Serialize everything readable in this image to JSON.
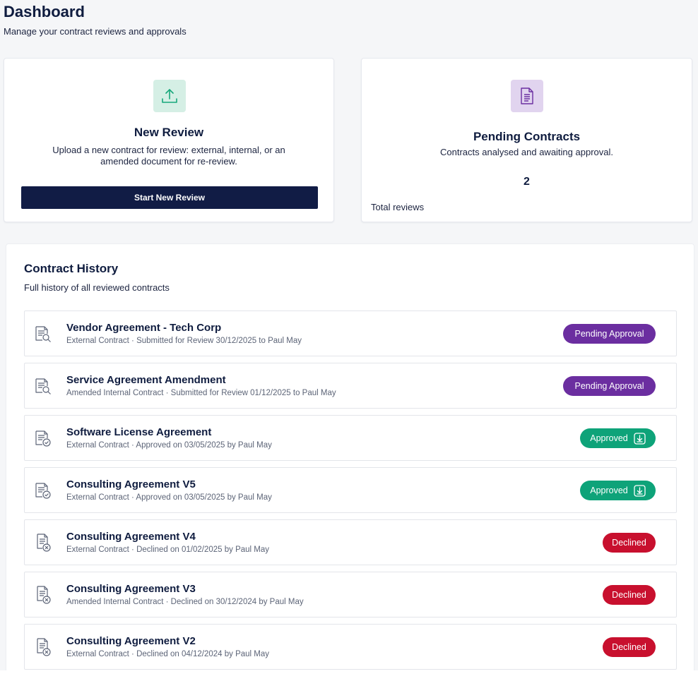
{
  "header": {
    "title": "Dashboard",
    "subtitle": "Manage your contract reviews and approvals"
  },
  "new_review": {
    "icon": "upload-icon",
    "title": "New Review",
    "description": "Upload a new contract for review: external, internal, or an amended document for re-review.",
    "button_label": "Start New Review"
  },
  "pending": {
    "icon": "document-icon",
    "title": "Pending Contracts",
    "description": "Contracts analysed and awaiting approval.",
    "count": "2",
    "count_label": "Total reviews"
  },
  "history": {
    "title": "Contract History",
    "subtitle": "Full history of all reviewed contracts",
    "rows": [
      {
        "icon": "document-search-icon",
        "title": "Vendor Agreement - Tech Corp",
        "meta": "External Contract · Submitted for Review 30/12/2025 to Paul May",
        "status": "Pending Approval",
        "status_type": "pending"
      },
      {
        "icon": "document-search-icon",
        "title": "Service Agreement Amendment",
        "meta": "Amended Internal Contract · Submitted for Review 01/12/2025 to Paul May",
        "status": "Pending Approval",
        "status_type": "pending"
      },
      {
        "icon": "document-check-icon",
        "title": "Software License Agreement",
        "meta": "External Contract · Approved on 03/05/2025 by Paul May",
        "status": "Approved",
        "status_type": "approved"
      },
      {
        "icon": "document-check-icon",
        "title": "Consulting Agreement V5",
        "meta": "External Contract · Approved on 03/05/2025 by Paul May",
        "status": "Approved",
        "status_type": "approved"
      },
      {
        "icon": "document-x-icon",
        "title": "Consulting Agreement V4",
        "meta": "External Contract · Declined on 01/02/2025 by Paul May",
        "status": "Declined",
        "status_type": "declined"
      },
      {
        "icon": "document-x-icon",
        "title": "Consulting Agreement V3",
        "meta": "Amended Internal Contract · Declined on 30/12/2024 by Paul May",
        "status": "Declined",
        "status_type": "declined"
      },
      {
        "icon": "document-x-icon",
        "title": "Consulting Agreement V2",
        "meta": "External Contract · Declined on 04/12/2024 by Paul May",
        "status": "Declined",
        "status_type": "declined"
      }
    ]
  },
  "colors": {
    "primary_navy": "#111c45",
    "pending": "#6b2ea0",
    "approved": "#0ea379",
    "declined": "#c8102e",
    "upload_bg": "#d5efe5",
    "doc_bg": "#e1d4ef"
  }
}
